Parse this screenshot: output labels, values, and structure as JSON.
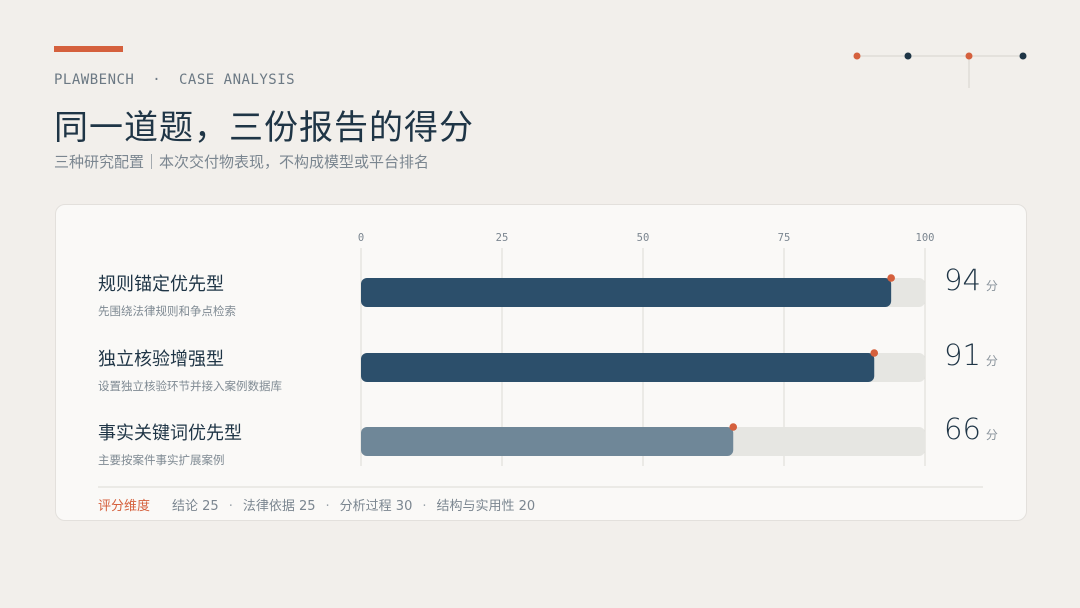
{
  "header": {
    "kicker": "PLAWBENCH  ·  CASE ANALYSIS",
    "title": "同一道题，三份报告的得分",
    "subtitle": "三种研究配置｜本次交付物表现，不构成模型或平台排名"
  },
  "colors": {
    "accent": "#d5603d",
    "navy": "#2c4f6b",
    "slate": "#6f8798",
    "track": "#e6e6e2"
  },
  "chart_data": {
    "type": "bar",
    "orientation": "horizontal",
    "xlim": [
      0,
      100
    ],
    "ticks": [
      "0",
      "25",
      "50",
      "75",
      "100"
    ],
    "grid": true,
    "categories": [
      "规则锚定优先型",
      "独立核验增强型",
      "事实关键词优先型"
    ],
    "descriptions": [
      "先围绕法律规则和争点检索",
      "设置独立核验环节并接入案例数据库",
      "主要按案件事实扩展案例"
    ],
    "values": [
      94,
      91,
      66
    ],
    "unit": "分",
    "bar_colors": [
      "#2c4f6b",
      "#2c4f6b",
      "#6f8798"
    ]
  },
  "footer": {
    "lead": "评分维度",
    "items": [
      "结论 25",
      "法律依据 25",
      "分析过程 30",
      "结构与实用性 20"
    ]
  }
}
